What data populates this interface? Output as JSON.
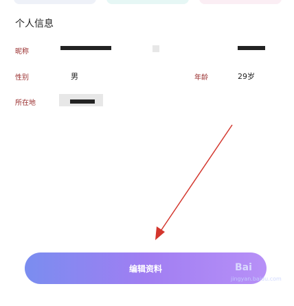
{
  "section_title": "个人信息",
  "fields": {
    "nickname_label": "昵称",
    "gender_label": "性别",
    "gender_value": "男",
    "age_label": "年龄",
    "age_value": "29岁",
    "location_label": "所在地"
  },
  "action_button": "编辑资料",
  "watermark": {
    "brand": "Bai",
    "site": "jingyan.baidu.com"
  },
  "colors": {
    "label": "#9a2f2f",
    "button_gradient_start": "#7a8df0",
    "button_gradient_end": "#b790f7",
    "arrow": "#d3362d"
  }
}
